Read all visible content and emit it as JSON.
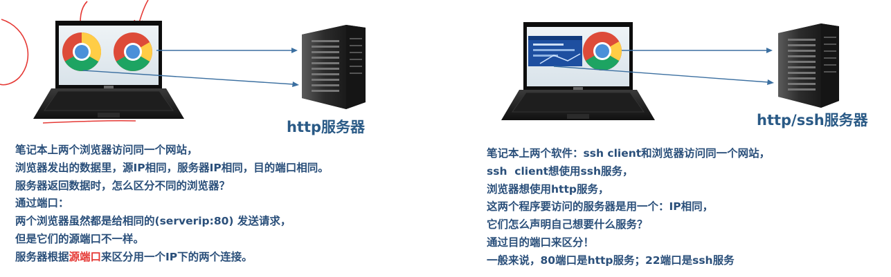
{
  "left": {
    "server_label": "http服务器",
    "lines": [
      "笔记本上两个浏览器访问同一个网站，",
      "浏览器发出的数据里，源IP相同，服务器IP相同，目的端口相同。",
      "服务器返回数据时，怎么区分不同的浏览器？",
      "通过端口：",
      "两个浏览器虽然都是给相同的(serverip:80) 发送请求，",
      "但是它们的源端口不一样。"
    ],
    "last_line": {
      "before": "服务器根据",
      "highlight": "源端口",
      "after": "来区分用一个IP下的两个连接。"
    }
  },
  "right": {
    "server_label": "http/ssh服务器",
    "lines": [
      "笔记本上两个软件：ssh client和浏览器访问同一个网站，",
      "ssh  client想使用ssh服务，",
      "浏览器想使用http服务，",
      "这两个程序要访问的服务器是用一个：IP相同，",
      "它们怎么声明自己想要什么服务？",
      "通过目的端口来区分！",
      "一般来说，80端口是http服务；22端口是ssh服务"
    ]
  },
  "colors": {
    "text": "#2a4f7a",
    "caption": "#2a5a86",
    "highlight": "#e53935",
    "annotation": "#e53935"
  },
  "icons": [
    "laptop-icon",
    "chrome-icon",
    "server-icon",
    "ssh-client-window-icon"
  ]
}
